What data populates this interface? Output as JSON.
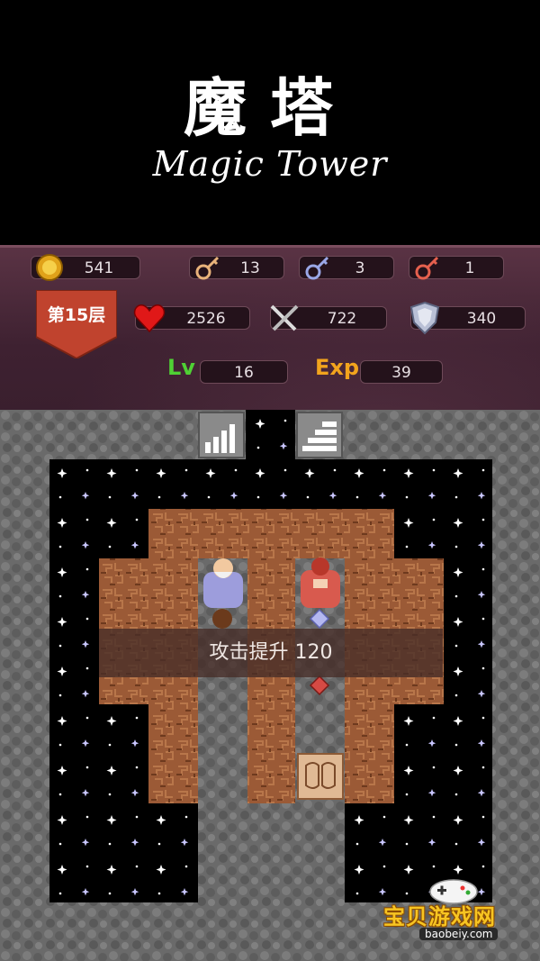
{
  "title": {
    "cn": "魔塔",
    "en": "Magic Tower"
  },
  "hud": {
    "gold": "541",
    "key_yellow": "13",
    "key_blue": "3",
    "key_red": "1",
    "floor": "第15层",
    "hp": "2526",
    "attack": "722",
    "defense": "340",
    "level_label": "Lv",
    "level": "16",
    "exp_label": "Exp",
    "exp": "39"
  },
  "toast": "攻击提升 120",
  "watermark": {
    "cn": "宝贝游戏网",
    "en": "baobeiy.com"
  },
  "colors": {
    "hud_bg": "#4a2838",
    "floor_badge": "#c0432e",
    "wall": "#6b6b6b",
    "dirt": "#9a5a3a",
    "space": "#000000"
  }
}
